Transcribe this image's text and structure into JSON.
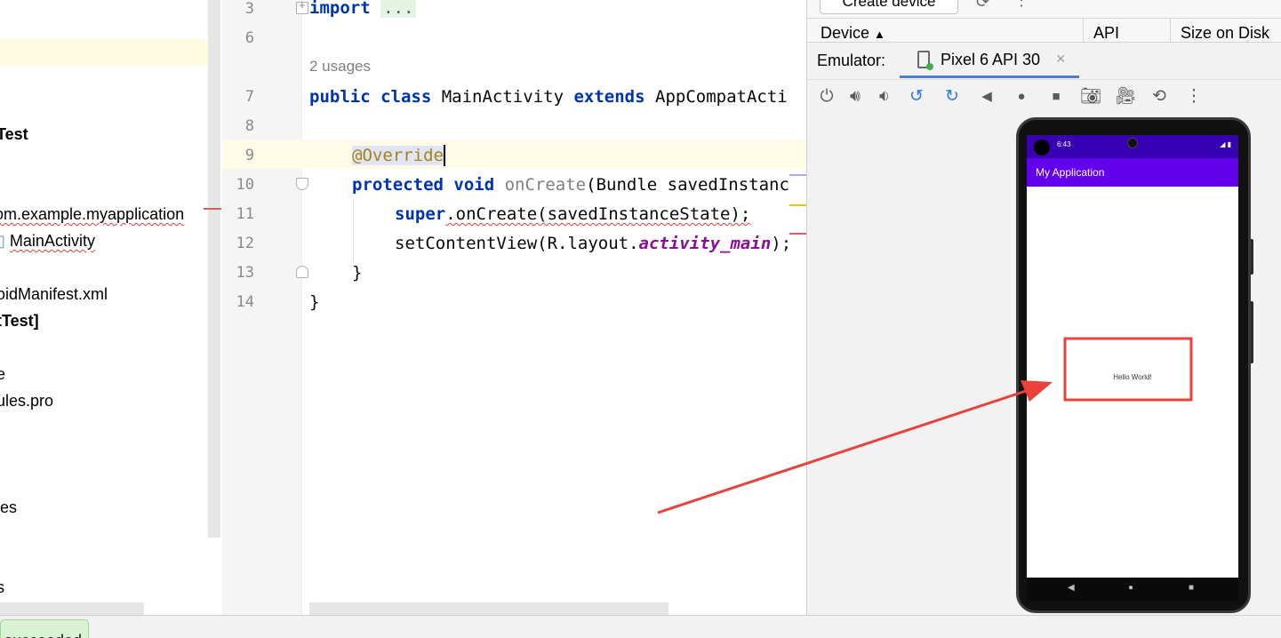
{
  "project_tree": {
    "items": [
      {
        "label": "Test"
      },
      {
        "label": "om.example.myapplication"
      },
      {
        "label": "MainActivity"
      },
      {
        "label": "oidManifest.xml"
      },
      {
        "label": "tTest]"
      },
      {
        "label": "e"
      },
      {
        "label": "ules.pro"
      },
      {
        "label": "ies"
      },
      {
        "label": "s"
      }
    ]
  },
  "editor": {
    "line_numbers": [
      "3",
      "6",
      "7",
      "8",
      "9",
      "10",
      "11",
      "12",
      "13",
      "14"
    ],
    "usages_hint": "2 usages",
    "code": {
      "import_kw": "import",
      "import_fold": "...",
      "class_decl_kw": "public class",
      "class_name": "MainActivity",
      "extends_kw": "extends",
      "extends_name": "AppCompatActi",
      "annotation": "@Override",
      "method_kw": "protected void",
      "method_name": "onCreate",
      "method_params": "(Bundle savedInstanc",
      "super_kw": "super",
      "super_call": ".onCreate(savedInstanceState);",
      "set_content": "setContentView(R.layout.",
      "layout_field": "activity_main",
      "set_content_end": ");",
      "close_method": "}",
      "close_class": "}"
    }
  },
  "device_manager": {
    "create_device_label": "Create device",
    "columns": [
      "Device",
      "API",
      "Size on Disk"
    ],
    "sort_indicator": "▲"
  },
  "emulator": {
    "label": "Emulator:",
    "tab_label": "Pixel 6 API 30",
    "tab_close": "×",
    "toolbar_icons": [
      "power-icon",
      "volume-up-icon",
      "volume-down-icon",
      "rotate-left-icon",
      "rotate-right-icon",
      "back-icon",
      "home-icon",
      "overview-icon",
      "screenshot-icon",
      "screenrecord-icon",
      "snapshot-icon",
      "more-icon"
    ]
  },
  "device_screen": {
    "status_time": "6:43",
    "app_title": "My Application",
    "hello_text": "Hello World!"
  },
  "status": {
    "toast_text": "succeeded"
  },
  "colors": {
    "app_bar": "#6200ee",
    "status_bar": "#3700b3",
    "annotation_red": "#e8423a",
    "keyword": "#0033b3"
  }
}
